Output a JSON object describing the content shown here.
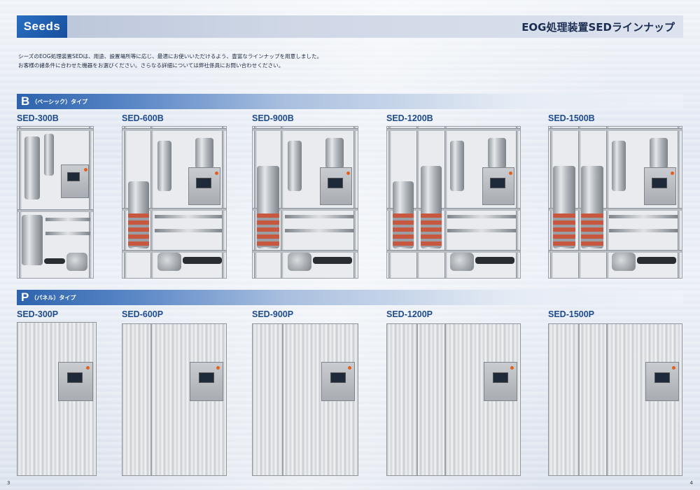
{
  "header": {
    "logo": "Seeds",
    "title": "EOG処理装置SEDラインナップ"
  },
  "intro": {
    "line1": "シーズのEOG処理装置SEDは、用途、設置場所等に応じ、最適にお使いいただけるよう、豊富なラインナップを用意しました。",
    "line2": "お客様の諸条件に合わせた機器をお選びください。さらなる詳細については弊社係員にお問い合わせください。"
  },
  "sections": [
    {
      "letter": "B",
      "label": "（ベーシック）タイプ",
      "models": [
        "SED-300B",
        "SED-600B",
        "SED-900B",
        "SED-1200B",
        "SED-1500B"
      ]
    },
    {
      "letter": "P",
      "label": "（パネル）タイプ",
      "models": [
        "SED-300P",
        "SED-600P",
        "SED-900P",
        "SED-1200P",
        "SED-1500P"
      ]
    }
  ],
  "pages": {
    "left": "3",
    "right": "4"
  },
  "colors": {
    "accent": "#2d63ad",
    "heater": "#c7573f",
    "lamp": "#e2611f"
  }
}
